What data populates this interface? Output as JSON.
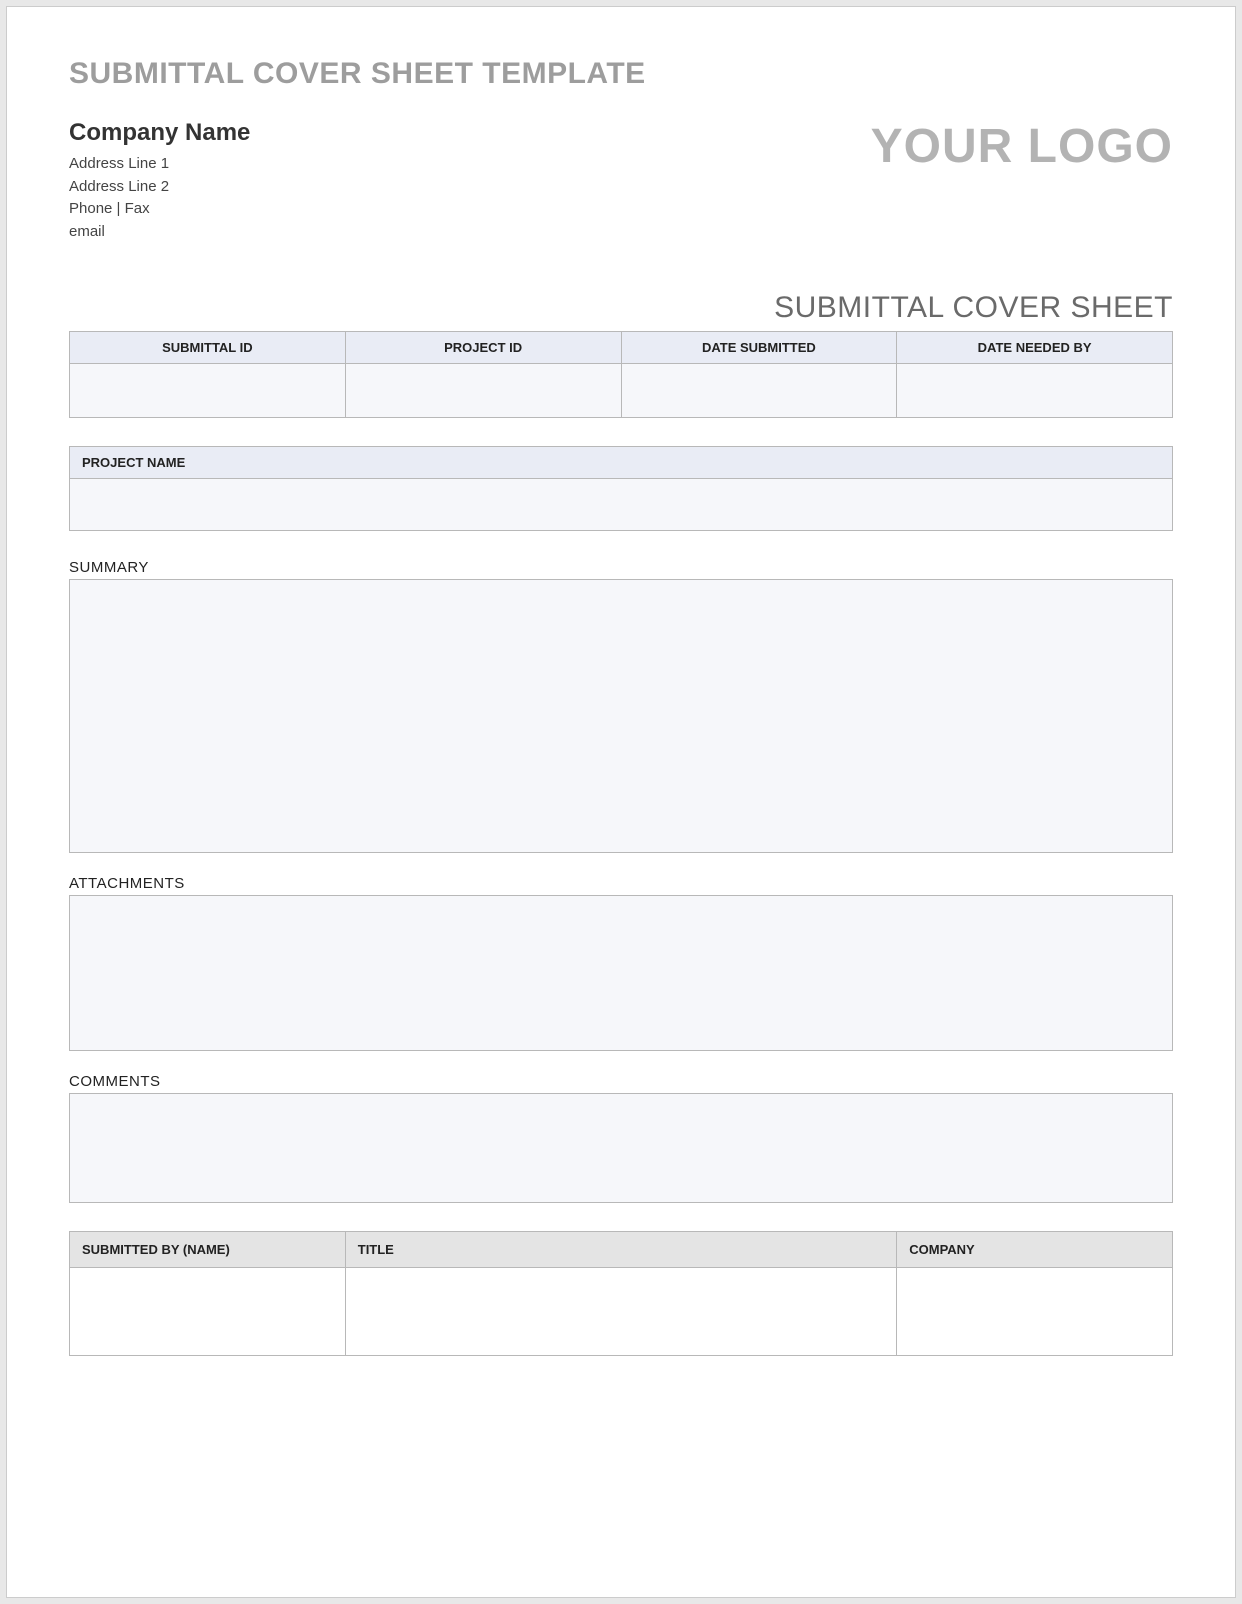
{
  "template_title": "SUBMITTAL COVER SHEET TEMPLATE",
  "company": {
    "name": "Company Name",
    "address1": "Address Line 1",
    "address2": "Address Line 2",
    "phone_fax": "Phone  |  Fax",
    "email": "email"
  },
  "logo_placeholder": "YOUR LOGO",
  "form_title": "SUBMITTAL COVER SHEET",
  "ids": {
    "headers": [
      "SUBMITTAL ID",
      "PROJECT ID",
      "DATE SUBMITTED",
      "DATE NEEDED BY"
    ],
    "values": [
      "",
      "",
      "",
      ""
    ]
  },
  "project_name": {
    "label": "PROJECT NAME",
    "value": ""
  },
  "sections": {
    "summary_label": "SUMMARY",
    "summary_value": "",
    "attachments_label": "ATTACHMENTS",
    "attachments_value": "",
    "comments_label": "COMMENTS",
    "comments_value": ""
  },
  "footer": {
    "headers": [
      "SUBMITTED BY (NAME)",
      "TITLE",
      "COMPANY"
    ],
    "values": [
      "",
      "",
      ""
    ]
  }
}
